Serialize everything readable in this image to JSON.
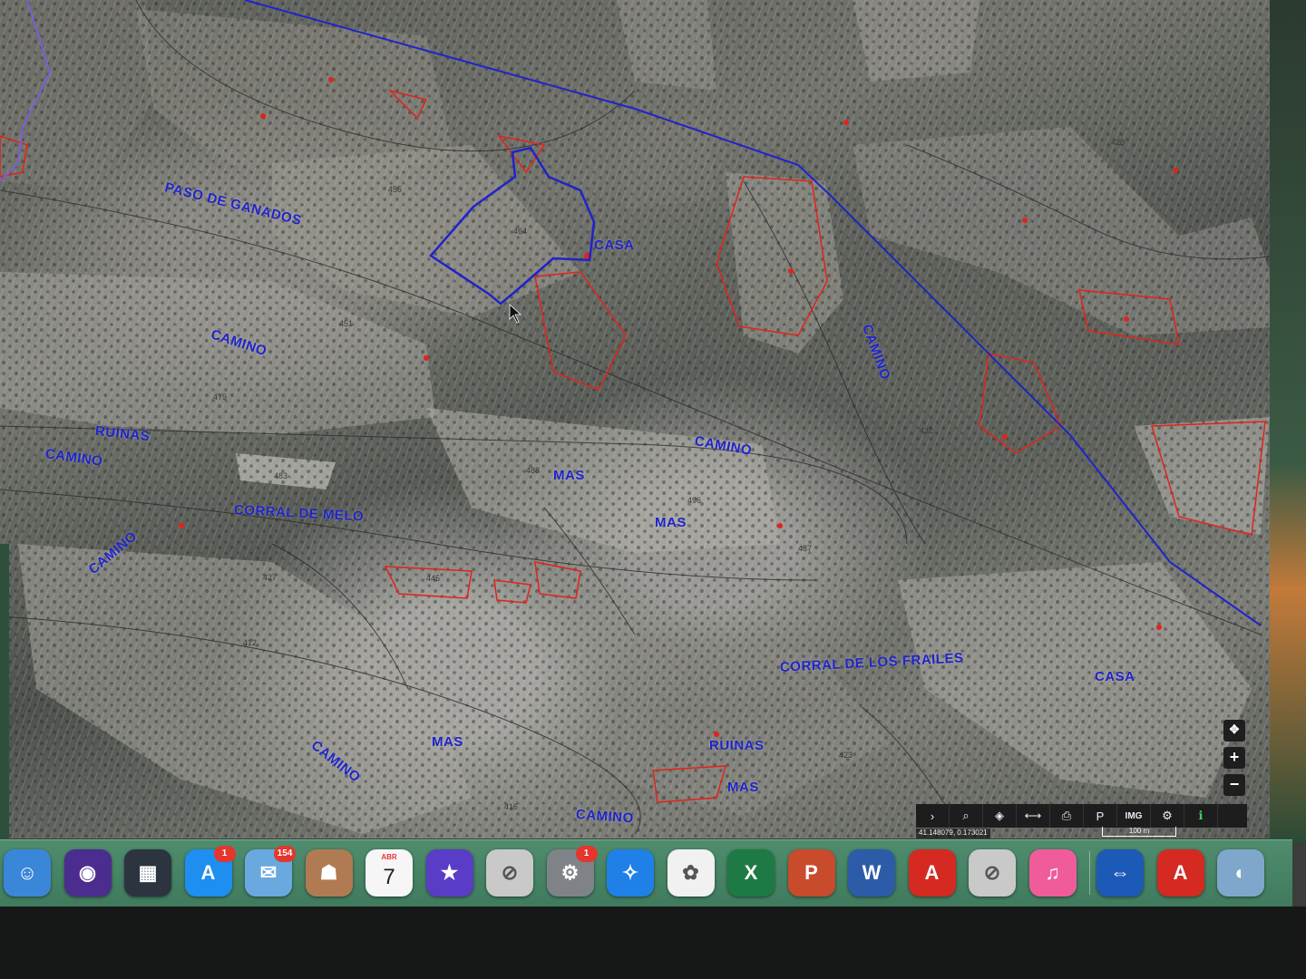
{
  "map": {
    "labels": [
      {
        "id": "paso-de-ganados",
        "text": "PASO DE GANADOS"
      },
      {
        "id": "casa-1",
        "text": "CASA"
      },
      {
        "id": "camino-1",
        "text": "CAMINO"
      },
      {
        "id": "camino-2",
        "text": "CAMINO"
      },
      {
        "id": "ruinas-1",
        "text": "RUINAS"
      },
      {
        "id": "camino-3",
        "text": "CAMINO"
      },
      {
        "id": "mas-1",
        "text": "MAS"
      },
      {
        "id": "camino-4",
        "text": "CAMINO"
      },
      {
        "id": "corral-de-melo",
        "text": "CORRAL DE MELO"
      },
      {
        "id": "mas-2",
        "text": "MAS"
      },
      {
        "id": "camino-5",
        "text": "CAMINO"
      },
      {
        "id": "corral-de-los-frailes",
        "text": "CORRAL DE LOS FRAILES"
      },
      {
        "id": "casa-2",
        "text": "CASA"
      },
      {
        "id": "camino-6",
        "text": "CAMINO"
      },
      {
        "id": "mas-3",
        "text": "MAS"
      },
      {
        "id": "ruinas-2",
        "text": "RUINAS"
      },
      {
        "id": "mas-4",
        "text": "MAS"
      },
      {
        "id": "camino-7",
        "text": "CAMINO"
      }
    ],
    "parcel_numbers": [
      "455",
      "464",
      "483",
      "488",
      "451",
      "496",
      "437",
      "445",
      "479",
      "423",
      "427",
      "412",
      "416",
      "432",
      "428"
    ],
    "colors": {
      "boundary": "#1f24c8",
      "parcel_red": "#e2231a",
      "label": "#1f24c8"
    }
  },
  "zoom": {
    "pan_icon": "move-icon",
    "plus": "+",
    "minus": "−"
  },
  "toolbar": {
    "items": [
      {
        "name": "expand",
        "glyph": "›"
      },
      {
        "name": "search",
        "glyph": "⌕"
      },
      {
        "name": "layers",
        "glyph": "◈"
      },
      {
        "name": "measure",
        "glyph": "⟷"
      },
      {
        "name": "print",
        "glyph": "⎙"
      },
      {
        "name": "parcel",
        "glyph": "P"
      },
      {
        "name": "img",
        "glyph": "IMG"
      },
      {
        "name": "tools",
        "glyph": "⚙"
      },
      {
        "name": "info",
        "glyph": "ℹ"
      }
    ],
    "coords": "41.148079, 0.173021",
    "scale": "100 m"
  },
  "dock": {
    "apps": [
      {
        "name": "finder",
        "glyph": "☺",
        "color": "#3a86d8"
      },
      {
        "name": "siri",
        "glyph": "◉",
        "color": "#4b2d8f"
      },
      {
        "name": "mission-control",
        "glyph": "▦",
        "color": "#2c3440"
      },
      {
        "name": "app-store",
        "glyph": "A",
        "color": "#1e8ef0",
        "badge": "1"
      },
      {
        "name": "mail",
        "glyph": "✉",
        "color": "#6aa8e0",
        "badge": "154"
      },
      {
        "name": "contacts",
        "glyph": "☗",
        "color": "#b07b52"
      },
      {
        "name": "calendar",
        "glyph": "7",
        "color": "#f6f6f6",
        "month": "ABR"
      },
      {
        "name": "imovie",
        "glyph": "★",
        "color": "#5a3dc6"
      },
      {
        "name": "prohibited-app-1",
        "glyph": "⊘",
        "color": "#c9c9c9"
      },
      {
        "name": "system-preferences",
        "glyph": "⚙",
        "color": "#7f8388",
        "badge": "1"
      },
      {
        "name": "safari",
        "glyph": "✧",
        "color": "#1f80e8"
      },
      {
        "name": "photos",
        "glyph": "✿",
        "color": "#f1f1f1"
      },
      {
        "name": "excel",
        "glyph": "X",
        "color": "#1e7a44"
      },
      {
        "name": "powerpoint",
        "glyph": "P",
        "color": "#c84b2c"
      },
      {
        "name": "word",
        "glyph": "W",
        "color": "#2c5ca8"
      },
      {
        "name": "acrobat",
        "glyph": "A",
        "color": "#d42a21"
      },
      {
        "name": "prohibited-app-2",
        "glyph": "⊘",
        "color": "#c9c9c9"
      },
      {
        "name": "itunes",
        "glyph": "♫",
        "color": "#f05c9a"
      },
      {
        "name": "teamviewer",
        "glyph": "⇔",
        "color": "#1c5ab8"
      },
      {
        "name": "acrobat-2",
        "glyph": "A",
        "color": "#d42a21"
      },
      {
        "name": "preview",
        "glyph": "◐",
        "color": "#7fa7cc"
      }
    ]
  }
}
